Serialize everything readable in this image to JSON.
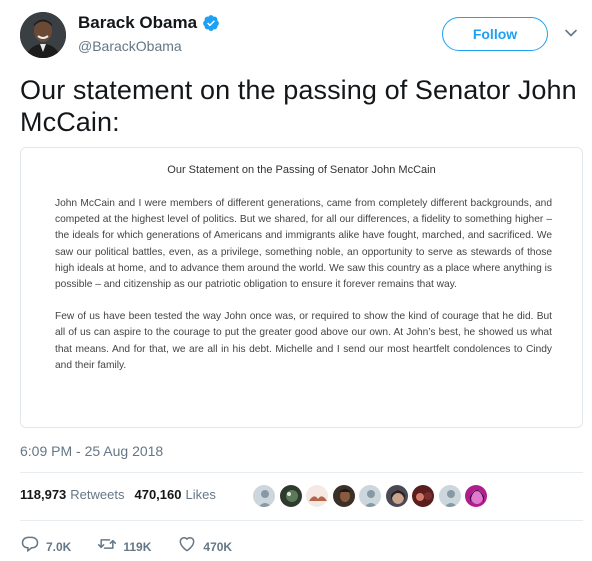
{
  "header": {
    "name": "Barack Obama",
    "handle": "@BarackObama",
    "verified_icon": "verified-badge-icon",
    "follow_label": "Follow",
    "menu_icon": "chevron-down-icon"
  },
  "tweet": {
    "text": "Our statement on the passing of Senator John McCain:"
  },
  "statement": {
    "title": "Our Statement on the Passing of Senator John McCain",
    "paragraphs": [
      "John McCain and I were members of different generations, came from completely different backgrounds, and competed at the highest level of politics. But we shared, for all our differences, a fidelity to something higher – the ideals for which generations of Americans and immigrants alike have fought, marched, and sacrificed. We saw our political battles, even, as a privilege, something noble, an opportunity to serve as stewards of those high ideals at home, and to advance them around the world. We saw this country as a place where anything is possible – and citizenship as our patriotic obligation to ensure it forever remains that way.",
      "Few of us have been tested the way John once was, or required to show the kind of courage that he did. But all of us can aspire to the courage to put the greater good above our own. At John’s best, he showed us what that means. And for that, we are all in his debt. Michelle and I send our most heartfelt condolences to Cindy and their family."
    ]
  },
  "timestamp": "6:09 PM - 25 Aug 2018",
  "stats": {
    "retweets_count": "118,973",
    "retweets_label": "Retweets",
    "likes_count": "470,160",
    "likes_label": "Likes"
  },
  "actions": {
    "reply_count": "7.0K",
    "retweet_count": "119K",
    "like_count": "470K"
  },
  "colors": {
    "accent": "#1da1f2",
    "secondary_text": "#657786",
    "primary_text": "#14171a"
  }
}
